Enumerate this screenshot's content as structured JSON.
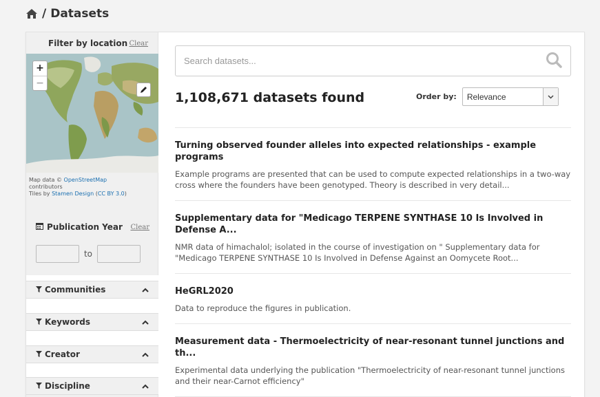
{
  "breadcrumb": {
    "current": "Datasets",
    "separator": "/"
  },
  "sidebar": {
    "location": {
      "label": "Filter by location",
      "clear": "Clear"
    },
    "map": {
      "zoom_in": "+",
      "zoom_out": "−",
      "attribution_prefix": "Map data © ",
      "osm_link": "OpenStreetMap",
      "contributors": "contributors",
      "tiles_prefix": "Tiles by ",
      "stamen_link": "Stamen Design",
      "license_open": " (",
      "license_link": "CC BY 3.0",
      "license_close": ")"
    },
    "publication_year": {
      "label": "Publication Year",
      "clear": "Clear",
      "to_label": "to",
      "from_value": "",
      "to_value": ""
    },
    "facets": [
      {
        "label": "Communities"
      },
      {
        "label": "Keywords"
      },
      {
        "label": "Creator"
      },
      {
        "label": "Discipline"
      }
    ]
  },
  "search": {
    "placeholder": "Search datasets..."
  },
  "results_count": "1,108,671 datasets found",
  "order_by": {
    "label": "Order by:",
    "selected": "Relevance"
  },
  "results": [
    {
      "title": "Turning observed founder alleles into expected relationships - example programs",
      "description": "Example programs are presented that can be used to compute expected relationships in a two-way cross where the founders have been genotyped. Theory is described in very detail..."
    },
    {
      "title": "Supplementary data for \"Medicago TERPENE SYNTHASE 10 Is Involved in Defense A...",
      "description": "NMR data of himachalol; isolated in the course of investigation on \" Supplementary data for \"Medicago TERPENE SYNTHASE 10 Is Involved in Defense Against an Oomycete Root..."
    },
    {
      "title": "HeGRL2020",
      "description": "Data to reproduce the figures in publication."
    },
    {
      "title": "Measurement data - Thermoelectricity of near-resonant tunnel junctions and th...",
      "description": "Experimental data underlying the publication \"Thermoelectricity of near-resonant tunnel junctions and their near-Carnot efficiency\""
    }
  ],
  "colors": {
    "link": "#1a6fb0",
    "sidebar_bg": "#f0f0f0",
    "panel_bg": "#ffffff",
    "page_bg": "#f3f3f3"
  }
}
